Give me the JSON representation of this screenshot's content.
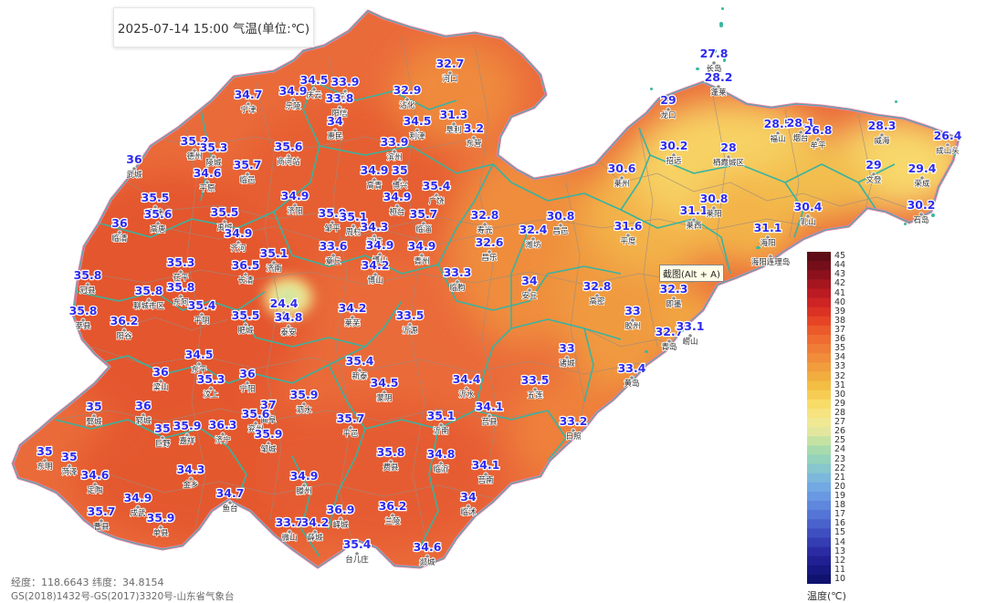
{
  "title": "2025-07-14 15:00 气温(单位:℃)",
  "coords_text": "经度：118.6643   纬度：34.8154",
  "copyright": "GS(2018)1432号-GS(2017)3320号-山东省气象台",
  "tooltip": "截图(Alt + A)",
  "legend": {
    "unit_label": "温度(℃)",
    "ticks": [
      45,
      44,
      43,
      42,
      41,
      40,
      39,
      38,
      37,
      36,
      35,
      34,
      33,
      32,
      31,
      30,
      29,
      28,
      27,
      26,
      25,
      24,
      23,
      22,
      21,
      20,
      19,
      18,
      17,
      16,
      15,
      14,
      13,
      12,
      11,
      10
    ],
    "colors": [
      "#5e0c16",
      "#740f1a",
      "#8c111c",
      "#a5161f",
      "#bb1b22",
      "#cd2424",
      "#db3323",
      "#e54525",
      "#eb5a2a",
      "#ee6c31",
      "#ef7c37",
      "#f08c3a",
      "#f19d3e",
      "#f2ad3f",
      "#f4bd44",
      "#f6cd52",
      "#f8dc68",
      "#f7e37f",
      "#f1e894",
      "#e3e79e",
      "#c4e3a3",
      "#a7dbad",
      "#94d2bb",
      "#87c6cc",
      "#7cb8db",
      "#72a9e3",
      "#6a99e3",
      "#5f87dd",
      "#5575d6",
      "#4a62cc",
      "#3f4fbf",
      "#353db2",
      "#2b2ca3",
      "#212092",
      "#171881",
      "#10126f"
    ]
  },
  "stations": [
    {
      "value": "34.7",
      "name": "宁津"
    },
    {
      "value": "34.9",
      "name": "乐陵"
    },
    {
      "value": "34.5",
      "name": "庆云"
    },
    {
      "value": "33.9",
      "name": "无棣"
    },
    {
      "value": "33.8",
      "name": "阳信"
    },
    {
      "value": "32.7",
      "name": "河口"
    },
    {
      "value": "32.9",
      "name": "沾化"
    },
    {
      "value": "34",
      "name": "惠民"
    },
    {
      "value": "34.5",
      "name": "利津"
    },
    {
      "value": "31.3",
      "name": "垦利"
    },
    {
      "value": "3.2",
      "name": "东营"
    },
    {
      "value": "35.2",
      "name": "德州"
    },
    {
      "value": "35.3",
      "name": "陵城"
    },
    {
      "value": "35.6",
      "name": "商河站"
    },
    {
      "value": "33.9",
      "name": "滨州"
    },
    {
      "value": "36",
      "name": "武城"
    },
    {
      "value": "34.6",
      "name": "平原"
    },
    {
      "value": "35.7",
      "name": "临邑"
    },
    {
      "value": "34.9",
      "name": "高青"
    },
    {
      "value": "35",
      "name": "博兴"
    },
    {
      "value": "35.4",
      "name": "广饶"
    },
    {
      "value": "35.5",
      "name": "夏津"
    },
    {
      "value": "34.9",
      "name": "济阳"
    },
    {
      "value": "34.9",
      "name": "桓台"
    },
    {
      "value": "35.6",
      "name": "高唐"
    },
    {
      "value": "35.5",
      "name": "禹城"
    },
    {
      "value": "35.9",
      "name": "邹平"
    },
    {
      "value": "35.1",
      "name": "周村"
    },
    {
      "value": "35.7",
      "name": "临淄"
    },
    {
      "value": "36",
      "name": "临清"
    },
    {
      "value": "34.3",
      "name": "淄博"
    },
    {
      "value": "32.8",
      "name": "寿光"
    },
    {
      "value": "32.4",
      "name": "潍坊"
    },
    {
      "value": "30.8",
      "name": "昌邑"
    },
    {
      "value": "34.9",
      "name": "齐河"
    },
    {
      "value": "33.6",
      "name": "章丘"
    },
    {
      "value": "34.9",
      "name": "博山"
    },
    {
      "value": "35.1",
      "name": "济南"
    },
    {
      "value": "34.9",
      "name": "青州"
    },
    {
      "value": "32.6",
      "name": "昌乐"
    },
    {
      "value": "35.3",
      "name": "茌平"
    },
    {
      "value": "36.5",
      "name": "长清"
    },
    {
      "value": "34.2",
      "name": "博山"
    },
    {
      "value": "33.3",
      "name": "临朐"
    },
    {
      "value": "35.8",
      "name": "冠县"
    },
    {
      "value": "35.8",
      "name": "聊城市区"
    },
    {
      "value": "35.8",
      "name": "东阿"
    },
    {
      "value": "35.4",
      "name": "平阴"
    },
    {
      "value": "34",
      "name": "安丘"
    },
    {
      "value": "32.8",
      "name": "高密"
    },
    {
      "value": "24.4",
      "name": "泰山"
    },
    {
      "value": "34.2",
      "name": "莱芜"
    },
    {
      "value": "33.5",
      "name": "沂源"
    },
    {
      "value": "35.8",
      "name": "莘县"
    },
    {
      "value": "36.2",
      "name": "阳谷"
    },
    {
      "value": "35.5",
      "name": "肥城"
    },
    {
      "value": "34.8",
      "name": "泰安"
    },
    {
      "value": "33",
      "name": "胶州"
    },
    {
      "value": "32.7",
      "name": "青岛"
    },
    {
      "value": "33.1",
      "name": "崂山"
    },
    {
      "value": "32.3",
      "name": "即墨"
    },
    {
      "value": "34.5",
      "name": "东平"
    },
    {
      "value": "33",
      "name": "诸城"
    },
    {
      "value": "36",
      "name": "梁山"
    },
    {
      "value": "35.3",
      "name": "汶上"
    },
    {
      "value": "36",
      "name": "宁阳"
    },
    {
      "value": "35.4",
      "name": "新泰"
    },
    {
      "value": "34.5",
      "name": "蒙阴"
    },
    {
      "value": "33.4",
      "name": "黄岛"
    },
    {
      "value": "35",
      "name": "鄄城"
    },
    {
      "value": "36",
      "name": "郓城"
    },
    {
      "value": "37",
      "name": "曲阜"
    },
    {
      "value": "35.6",
      "name": "兖州"
    },
    {
      "value": "35.9",
      "name": "泗水"
    },
    {
      "value": "34.4",
      "name": "沂水"
    },
    {
      "value": "33.5",
      "name": "五莲"
    },
    {
      "value": "35",
      "name": "巨野"
    },
    {
      "value": "35.9",
      "name": "嘉祥"
    },
    {
      "value": "36.3",
      "name": "济宁"
    },
    {
      "value": "35.9",
      "name": "邹城"
    },
    {
      "value": "35.7",
      "name": "平邑"
    },
    {
      "value": "35.1",
      "name": "沂南"
    },
    {
      "value": "34.1",
      "name": "莒县"
    },
    {
      "value": "33.2",
      "name": "日照"
    },
    {
      "value": "35",
      "name": "东明"
    },
    {
      "value": "35",
      "name": "菏泽"
    },
    {
      "value": "34.3",
      "name": "金乡"
    },
    {
      "value": "35.8",
      "name": "费县"
    },
    {
      "value": "34.8",
      "name": "临沂"
    },
    {
      "value": "34.1",
      "name": "莒南"
    },
    {
      "value": "34.6",
      "name": "定陶"
    },
    {
      "value": "34.9",
      "name": "成武"
    },
    {
      "value": "34.7",
      "name": "鱼台"
    },
    {
      "value": "34.9",
      "name": "滕州"
    },
    {
      "value": "34",
      "name": "临沭"
    },
    {
      "value": "35.7",
      "name": "曹县"
    },
    {
      "value": "35.9",
      "name": "单县"
    },
    {
      "value": "33.7",
      "name": "微山"
    },
    {
      "value": "34.2",
      "name": "薛城"
    },
    {
      "value": "36.9",
      "name": "峄城"
    },
    {
      "value": "36.2",
      "name": "兰陵"
    },
    {
      "value": "35.4",
      "name": "台儿庄"
    },
    {
      "value": "34.6",
      "name": "郯城"
    },
    {
      "value": "27.8",
      "name": "长岛"
    },
    {
      "value": "28.2",
      "name": "蓬莱"
    },
    {
      "value": "29",
      "name": "龙口"
    },
    {
      "value": "28.5",
      "name": "福山"
    },
    {
      "value": "28.1",
      "name": "烟台"
    },
    {
      "value": "26.8",
      "name": "牟平"
    },
    {
      "value": "28.3",
      "name": "威海"
    },
    {
      "value": "26.4",
      "name": "成山头"
    },
    {
      "value": "30.2",
      "name": "招远"
    },
    {
      "value": "28",
      "name": "栖霞城区"
    },
    {
      "value": "29",
      "name": "文登"
    },
    {
      "value": "29.4",
      "name": "荣成"
    },
    {
      "value": "30.6",
      "name": "莱州"
    },
    {
      "value": "31.1",
      "name": "莱西"
    },
    {
      "value": "30.8",
      "name": "莱阳"
    },
    {
      "value": "30.4",
      "name": "乳山"
    },
    {
      "value": "30.2",
      "name": "石岛"
    },
    {
      "value": "31.6",
      "name": "平度"
    },
    {
      "value": "31.1",
      "name": "海阳"
    },
    {
      "value": "",
      "name": "海阳连理岛"
    }
  ]
}
